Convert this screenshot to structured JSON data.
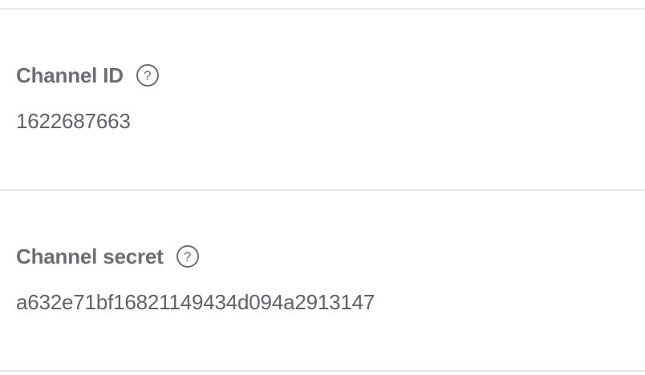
{
  "basic_settings": {
    "channel_id": {
      "label": "Channel ID",
      "help_icon": "question-circle-icon",
      "help_glyph": "?",
      "value": "1622687663"
    },
    "channel_secret": {
      "label": "Channel secret",
      "help_icon": "question-circle-icon",
      "help_glyph": "?",
      "value": "a632e71bf16821149434d094a2913147"
    }
  },
  "colors": {
    "text": "#6b6e73",
    "divider": "#e3e6ea",
    "background": "#ffffff"
  }
}
